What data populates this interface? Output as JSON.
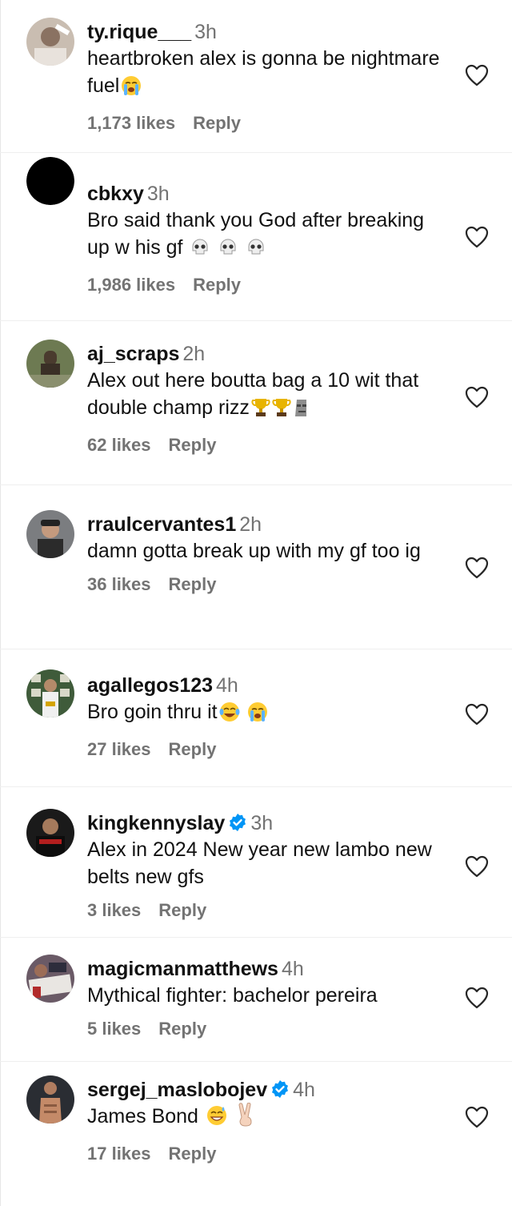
{
  "comments": [
    {
      "username": "ty.rique___",
      "time": "3h",
      "verified": false,
      "text": "heartbroken alex is gonna be nightmare fuel",
      "emojis": [
        "loudly-crying-face-emoji"
      ],
      "likes": "1,173 likes",
      "reply": "Reply"
    },
    {
      "username": "cbkxy",
      "time": "3h",
      "verified": false,
      "text": "Bro said thank you God after breaking up w his gf",
      "emojis": [
        "skull-emoji",
        "skull-emoji",
        "skull-emoji"
      ],
      "likes": "1,986 likes",
      "reply": "Reply"
    },
    {
      "username": "aj_scraps",
      "time": "2h",
      "verified": false,
      "text": "Alex out here boutta bag a 10 wit that double champ rizz",
      "emojis": [
        "trophy-emoji",
        "trophy-emoji",
        "moai-emoji"
      ],
      "likes": "62 likes",
      "reply": "Reply"
    },
    {
      "username": "rraulcervantes1",
      "time": "2h",
      "verified": false,
      "text": "damn gotta break up with my gf too ig",
      "emojis": [],
      "likes": "36 likes",
      "reply": "Reply"
    },
    {
      "username": "agallegos123",
      "time": "4h",
      "verified": false,
      "text": "Bro goin thru it",
      "emojis": [
        "tears-of-joy-emoji",
        "loudly-crying-face-emoji"
      ],
      "likes": "27 likes",
      "reply": "Reply"
    },
    {
      "username": "kingkennyslay",
      "time": "3h",
      "verified": true,
      "text": "Alex in 2024 New year new lambo new belts new gfs",
      "emojis": [],
      "likes": "3 likes",
      "reply": "Reply"
    },
    {
      "username": "magicmanmatthews",
      "time": "4h",
      "verified": false,
      "text": "Mythical fighter: bachelor pereira",
      "emojis": [],
      "likes": "5 likes",
      "reply": "Reply"
    },
    {
      "username": "sergej_maslobojev",
      "time": "4h",
      "verified": true,
      "text": "James Bond",
      "emojis": [
        "grinning-sweat-emoji",
        "victory-hand-emoji"
      ],
      "likes": "17 likes",
      "reply": "Reply"
    }
  ],
  "colors": {
    "muted": "#737373",
    "verified": "#0095f6",
    "text": "#111111"
  }
}
